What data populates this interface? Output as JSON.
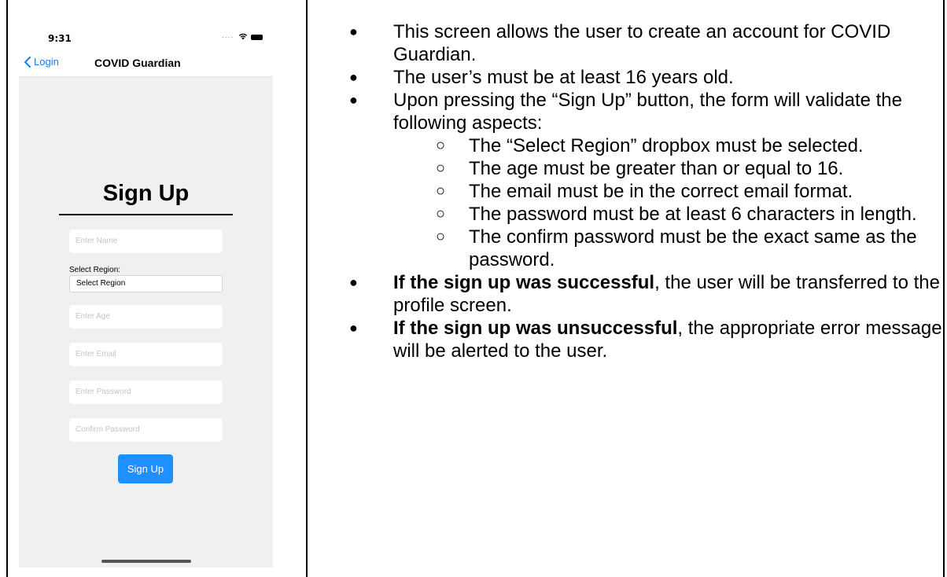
{
  "phone": {
    "status_time": "9:31",
    "status_dots": "....",
    "nav": {
      "back_label": "Login",
      "title": "COVID Guardian"
    },
    "form": {
      "title": "Sign Up",
      "name_placeholder": "Enter Name",
      "region_label": "Select Region:",
      "region_value": "Select Region",
      "age_placeholder": "Enter Age",
      "email_placeholder": "Enter Email",
      "password_placeholder": "Enter Password",
      "confirm_placeholder": "Confirm Password",
      "submit_label": "Sign Up"
    },
    "colors": {
      "accent": "#1e90ff",
      "back_link": "#147efb",
      "background": "#f0f0f0"
    }
  },
  "description": {
    "b1": "This screen allows the user to create an account for COVID Guardian.",
    "b2": "The user’s must be at least 16 years old.",
    "b3": "Upon pressing the “Sign Up” button, the form will validate the following aspects:",
    "s1": "The “Select Region” dropbox must be selected.",
    "s2": "The age must be greater than or equal to 16.",
    "s3": "The email must be in the correct email format.",
    "s4": "The password must be at least 6 characters in length.",
    "s5": "The confirm password must be the exact same as the password.",
    "b4_bold": "If the sign up was successful",
    "b4_rest": ", the user will be transferred to the profile screen.",
    "b5_bold": "If the sign up was unsuccessful",
    "b5_rest": ", the appropriate error message will be alerted to the user."
  }
}
